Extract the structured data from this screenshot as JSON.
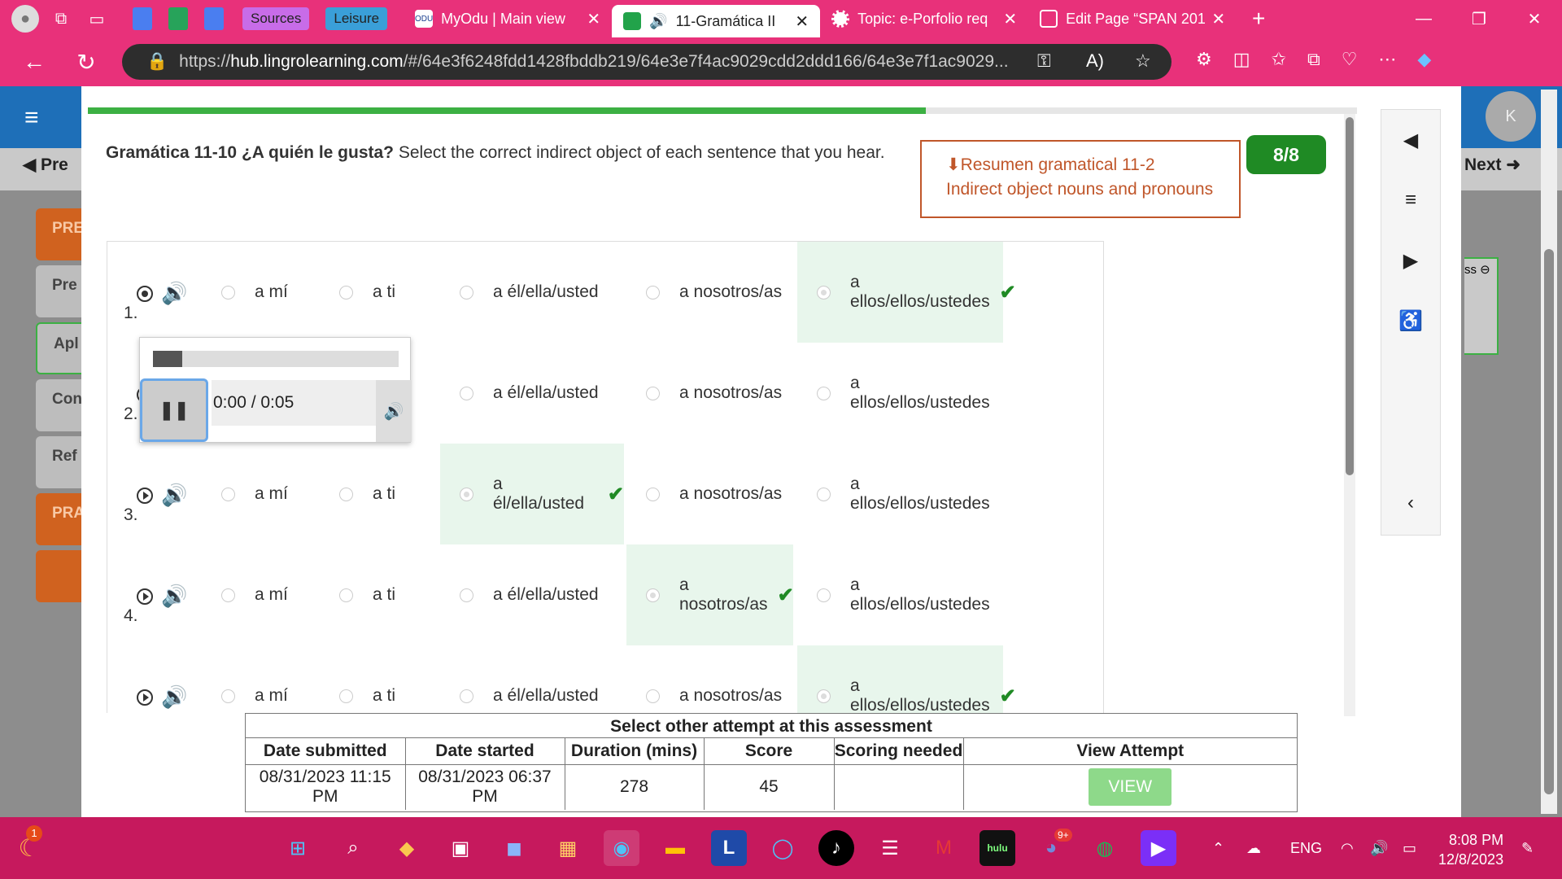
{
  "browser": {
    "pinned": [
      "Sources",
      "Leisure"
    ],
    "tabs": [
      {
        "title": "MyOdu | Main view"
      },
      {
        "title": "11-Gramática II"
      },
      {
        "title": "Topic: e-Porfolio req"
      },
      {
        "title": "Edit Page “SPAN 201"
      }
    ],
    "url_prefix": "https://",
    "url_host": "hub.lingrolearning.com",
    "url_path": "/#/64e3f6248fdd1428fbddb219/64e3e7f4ac9029cdd2ddd166/64e3e7f1ac9029..."
  },
  "lms": {
    "prev_label": "Pre",
    "next_label": "Next",
    "avatar_initial": "K",
    "side_cards": [
      "PRE",
      "Pre",
      "Apl",
      "Con",
      "Ref",
      "PRA"
    ],
    "badge_text": "ss"
  },
  "activity": {
    "progress_pct": 66,
    "title_bold": "Gramática 11-10 ¿A quién le gusta?",
    "title_rest": " Select the correct indirect object of each sentence that you hear.",
    "resumen_line1": "Resumen gramatical 11-2",
    "resumen_line2": "Indirect object nouns and pronouns",
    "score": "8/8",
    "options": [
      "a mí",
      "a ti",
      "a él/ella/usted",
      "a nosotros/as",
      "a ellos/ellos/ustedes"
    ],
    "questions": [
      {
        "num": "1.",
        "correct_index": 4
      },
      {
        "num": "2.",
        "correct_index": -1
      },
      {
        "num": "3.",
        "correct_index": 2
      },
      {
        "num": "4.",
        "correct_index": 3
      },
      {
        "num": "",
        "correct_index": 4
      }
    ],
    "audio": {
      "time": "0:00 / 0:05",
      "progress_pct": 12
    }
  },
  "attempts": {
    "caption": "Select other attempt at this assessment",
    "headers": [
      "Date submitted",
      "Date started",
      "Duration (mins)",
      "Score",
      "Scoring needed",
      "View Attempt"
    ],
    "row": {
      "submitted": "08/31/2023 11:15 PM",
      "started": "08/31/2023 06:37 PM",
      "duration": "278",
      "score": "45",
      "scoring": "",
      "view": "VIEW"
    }
  },
  "taskbar": {
    "notif_badge": "1",
    "discord_badge": "9+",
    "lang": "ENG",
    "time": "8:08 PM",
    "date": "12/8/2023"
  },
  "colors": {
    "browser": "#e8317a",
    "taskbar": "#c6195d",
    "correct": "#1f8a24",
    "resumen": "#c0562a"
  }
}
